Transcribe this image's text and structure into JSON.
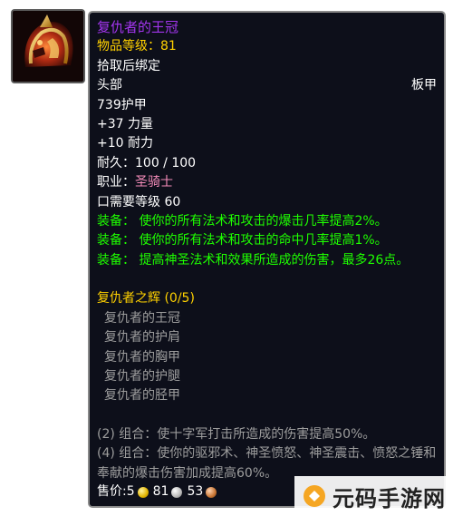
{
  "item": {
    "name": "复仇者的王冠",
    "item_level": "物品等级：81",
    "bind": "拾取后绑定",
    "slot": "头部",
    "armor_type": "板甲",
    "armor": "739护甲",
    "stat_strength": "+37 力量",
    "stat_stamina": "+10 耐力",
    "durability": "耐久：100 / 100",
    "class_label": "职业：",
    "class_value": "圣骑士",
    "level_req": "口需要等级 60",
    "equip_effects": [
      "装备：  使你的所有法术和攻击的爆击几率提高2%。",
      "装备：  使你的所有法术和攻击的命中几率提高1%。",
      "装备：  提高神圣法术和效果所造成的伤害，最多26点。"
    ]
  },
  "set": {
    "title": "复仇者之辉 (0/5)",
    "pieces": [
      "复仇者的王冠",
      "复仇者的护肩",
      "复仇者的胸甲",
      "复仇者的护腿",
      "复仇者的胫甲"
    ],
    "bonuses": [
      "(2) 组合：使十字军打击所造成的伤害提高50%。",
      "(4) 组合：使你的驱邪术、神圣愤怒、神圣震击、愤怒之锤和奉献的爆击伤害加成提高60%。"
    ]
  },
  "sell": {
    "label": "售价: ",
    "gold": "5",
    "silver": "81",
    "copper": "53"
  },
  "icon": "helmet-icon",
  "watermark": {
    "text": "元码手游网"
  },
  "colors": {
    "epic_purple": "#a335ee",
    "item_level_yellow": "#ffd100",
    "equip_green": "#1eff00",
    "set_gold": "#ffd100",
    "inactive_gray": "#9d9d9d",
    "paladin_pink": "#f58cba",
    "tooltip_bg": "#0d0f1a"
  }
}
